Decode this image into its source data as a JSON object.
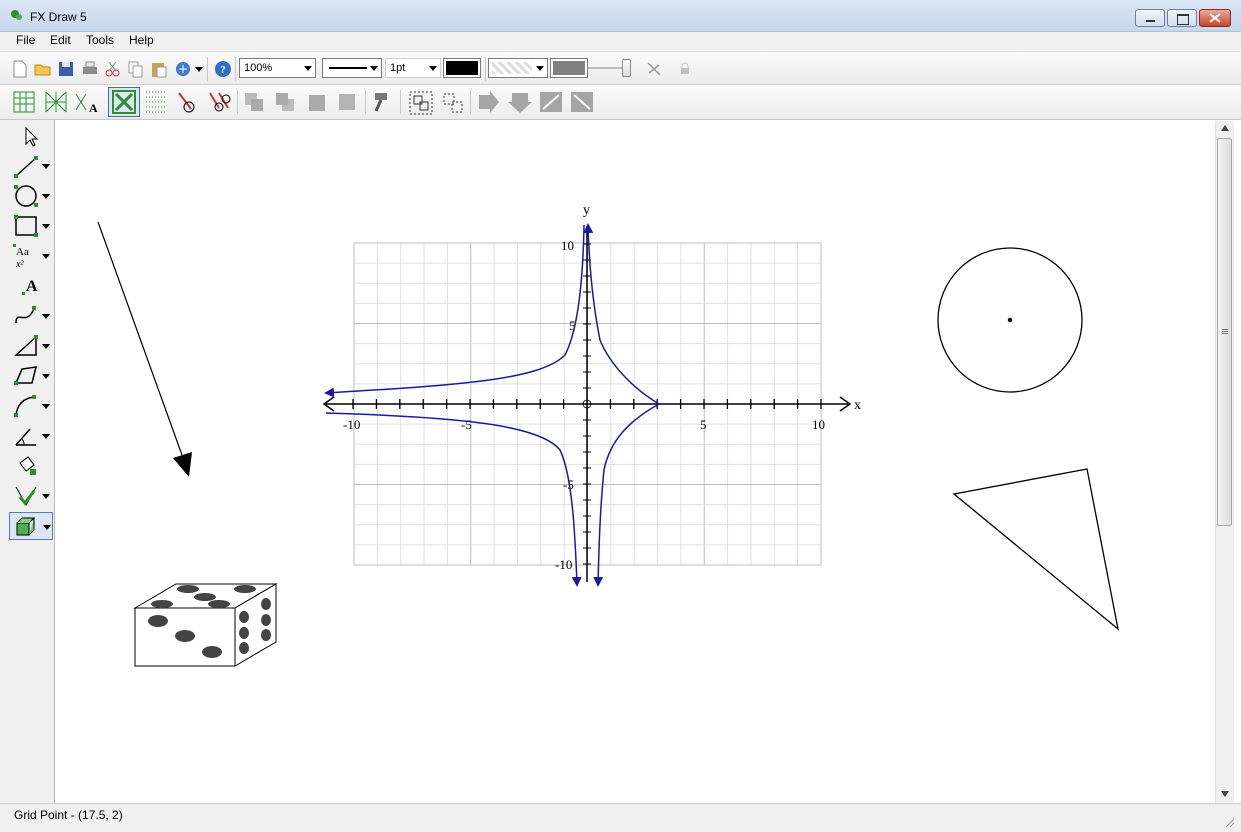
{
  "window": {
    "title": "FX Draw 5"
  },
  "menu": {
    "items": [
      "File",
      "Edit",
      "Tools",
      "Help"
    ]
  },
  "toolbar": {
    "zoom_value": "100%",
    "line_width_value": "1pt",
    "line_color": "#000000",
    "fill_color": "#808080"
  },
  "graph": {
    "x_axis_label": "x",
    "y_axis_label": "y",
    "x_ticks": [
      "-10",
      "-5",
      "5",
      "10"
    ],
    "y_ticks": [
      "10",
      "5",
      "-5",
      "-10"
    ],
    "curve_color": "#1a1aa0"
  },
  "status": {
    "text": "Grid Point - (17.5, 2)"
  }
}
